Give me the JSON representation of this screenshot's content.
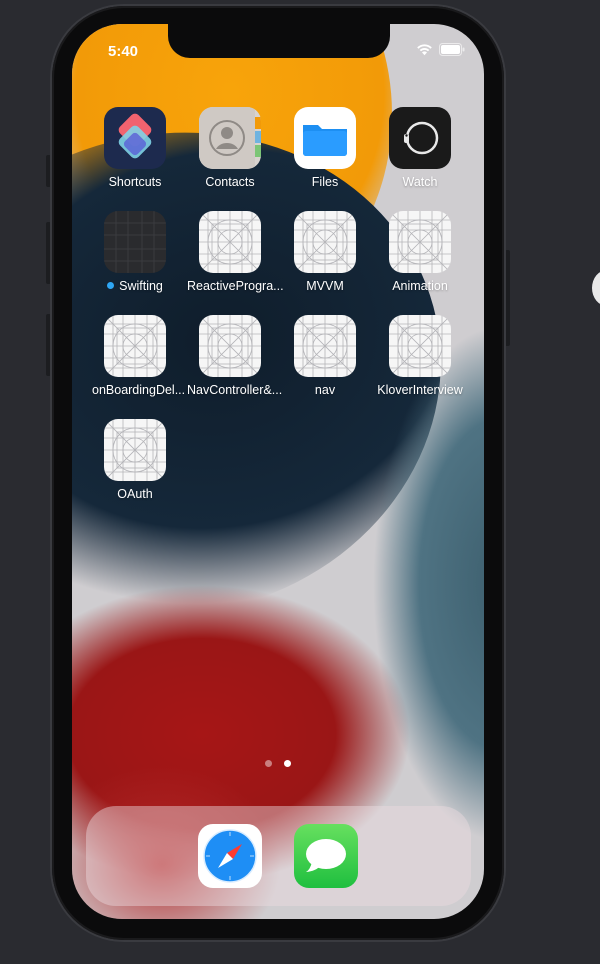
{
  "status_bar": {
    "time": "5:40"
  },
  "apps": [
    {
      "name": "Shortcuts",
      "icon": "shortcuts-icon"
    },
    {
      "name": "Contacts",
      "icon": "contacts-icon"
    },
    {
      "name": "Files",
      "icon": "files-icon"
    },
    {
      "name": "Watch",
      "icon": "watch-icon"
    },
    {
      "name": "Swifting",
      "icon": "dark-app-icon",
      "badge_dot": "blue"
    },
    {
      "name": "ReactiveProgra...",
      "icon": "placeholder-grid-icon"
    },
    {
      "name": "MVVM",
      "icon": "placeholder-grid-icon"
    },
    {
      "name": "Animation",
      "icon": "placeholder-grid-icon"
    },
    {
      "name": "onBoardingDel...",
      "icon": "placeholder-grid-icon"
    },
    {
      "name": "NavController&...",
      "icon": "placeholder-grid-icon"
    },
    {
      "name": "nav",
      "icon": "placeholder-grid-icon"
    },
    {
      "name": "KloverInterview",
      "icon": "placeholder-grid-icon"
    },
    {
      "name": "OAuth",
      "icon": "placeholder-grid-icon"
    }
  ],
  "page_indicator": {
    "pages": 2,
    "current": 2
  },
  "dock": [
    {
      "icon": "safari-icon"
    },
    {
      "icon": "messages-icon"
    }
  ],
  "colors": {
    "wallpaper_orange": "#f29a08",
    "wallpaper_navy": "#15283a",
    "wallpaper_red": "#9a1616",
    "wallpaper_teal": "#4f7383",
    "badge_blue": "#2ea7f5"
  }
}
